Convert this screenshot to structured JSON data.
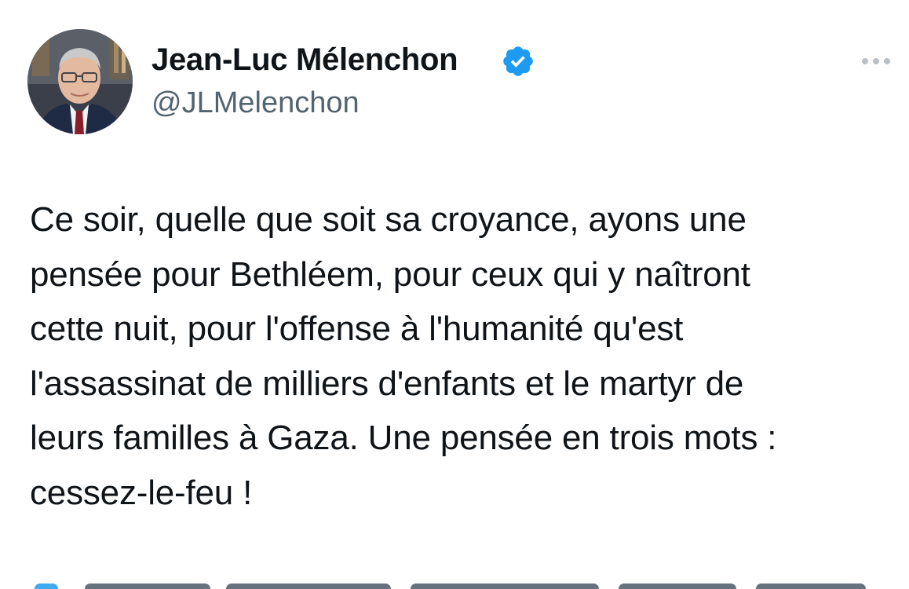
{
  "tweet": {
    "author": {
      "name": "Jean-Luc Mélenchon",
      "handle": "@JLMelenchon",
      "verified": true
    },
    "text": "Ce soir, quelle que soit sa croyance, ayons une\npensée pour Bethléem, pour  ceux qui y naîtront\ncette nuit, pour l'offense à l'humanité qu'est\nl'assassinat de milliers d'enfants et le martyr de\nleurs familles à Gaza. Une pensée en trois mots :\ncessez-le-feu !"
  },
  "icons": {
    "verified": "verified-badge-icon",
    "more": "more-options-icon"
  },
  "colors": {
    "accent": "#1d9bf0",
    "text": "#0f1419",
    "secondary": "#536471",
    "background": "#ffffff"
  }
}
